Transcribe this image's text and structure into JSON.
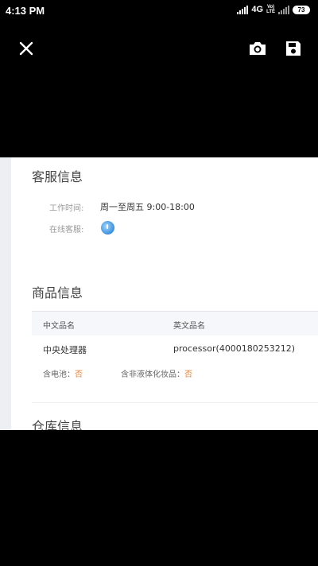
{
  "status_bar": {
    "time": "4:13 PM",
    "network": "4G",
    "volte_top": "Vo)",
    "volte_bottom": "LTE",
    "battery": "73"
  },
  "toolbar": {
    "close_icon": "close-icon",
    "camera_icon": "camera-icon",
    "save_icon": "save-icon"
  },
  "photo": {
    "customer_service": {
      "heading": "客服信息",
      "work_hours_label": "工作时间:",
      "work_hours_value": "周一至周五 9:00-18:00",
      "online_label": "在线客服:"
    },
    "product": {
      "heading": "商品信息",
      "table": {
        "headers": [
          "中文品名",
          "英文品名"
        ],
        "rows": [
          [
            "中央处理器",
            "processor(4000180253212)"
          ]
        ]
      },
      "battery_label": "含电池：",
      "battery_value": "否",
      "liquid_label": "含非液体化妆品：",
      "liquid_value": "否"
    },
    "warehouse": {
      "heading": "仓库信息"
    }
  }
}
